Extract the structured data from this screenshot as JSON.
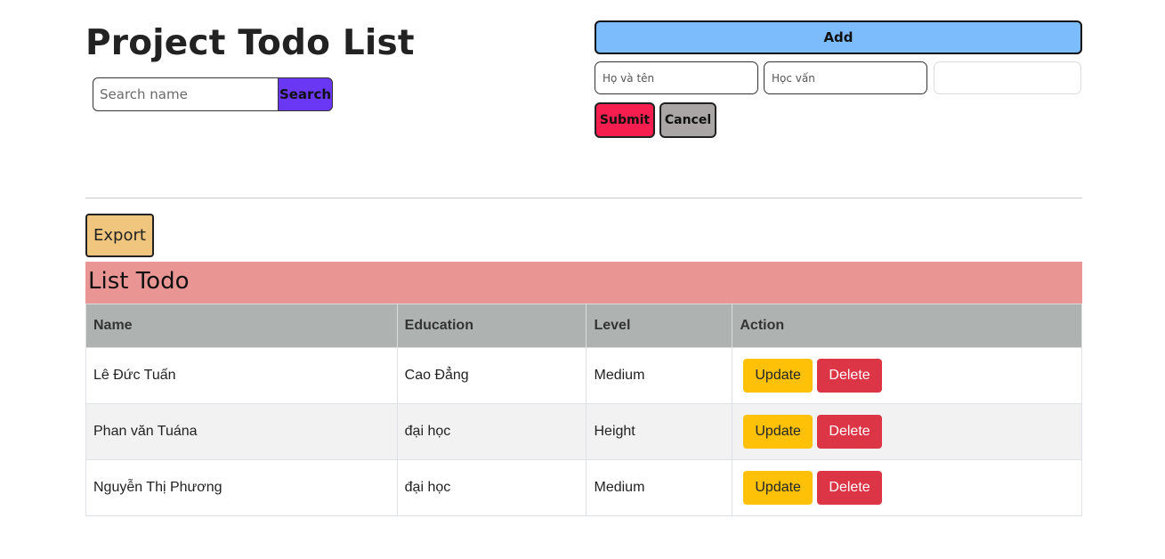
{
  "header": {
    "title": "Project Todo List"
  },
  "search": {
    "placeholder": "Search name",
    "value": "",
    "button_label": "Search"
  },
  "form": {
    "add_label": "Add",
    "name_placeholder": "Họ và tên",
    "education_placeholder": "Học vấn",
    "level_value": "",
    "submit_label": "Submit",
    "cancel_label": "Cancel"
  },
  "export": {
    "label": "Export"
  },
  "list": {
    "title": "List Todo",
    "columns": [
      "Name",
      "Education",
      "Level",
      "Action"
    ],
    "rows": [
      {
        "name": "Lê Đức Tuấn",
        "education": "Cao Đẳng",
        "level": "Medium",
        "update": "Update",
        "delete": "Delete"
      },
      {
        "name": "Phan văn Tuána",
        "education": "đại học",
        "level": "Height",
        "update": "Update",
        "delete": "Delete"
      },
      {
        "name": "Nguyễn Thị Phương",
        "education": "đại học",
        "level": "Medium",
        "update": "Update",
        "delete": "Delete"
      }
    ]
  },
  "colors": {
    "search_button": "#6a38f5",
    "add_button": "#7cbcfd",
    "submit_button": "#f51e4e",
    "cancel_button": "#aba6a6",
    "export_button": "#f0c67f",
    "list_header": "#e99594",
    "table_header": "#aeb3b2",
    "update_button": "#ffc107",
    "delete_button": "#dc3545"
  }
}
